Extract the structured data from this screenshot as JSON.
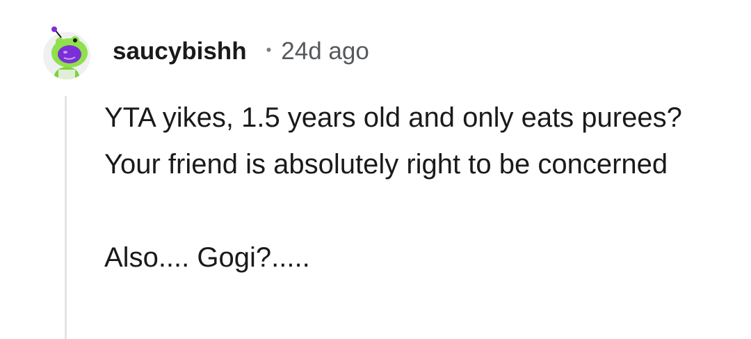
{
  "comment": {
    "username": "saucybishh",
    "separator": "•",
    "timestamp": "24d ago",
    "paragraphs": [
      "YTA yikes, 1.5 years old and only eats purees? Your friend is absolutely right to be concerned",
      "Also.... Gogi?....."
    ]
  },
  "colors": {
    "text": "#1a1a1b",
    "meta": "#555a5e",
    "thread_line": "#e2e4e6",
    "avatar_green": "#8fe04a",
    "avatar_purple": "#7b2fd6"
  },
  "icons": {
    "avatar": "snoo-frog-avatar-icon"
  }
}
